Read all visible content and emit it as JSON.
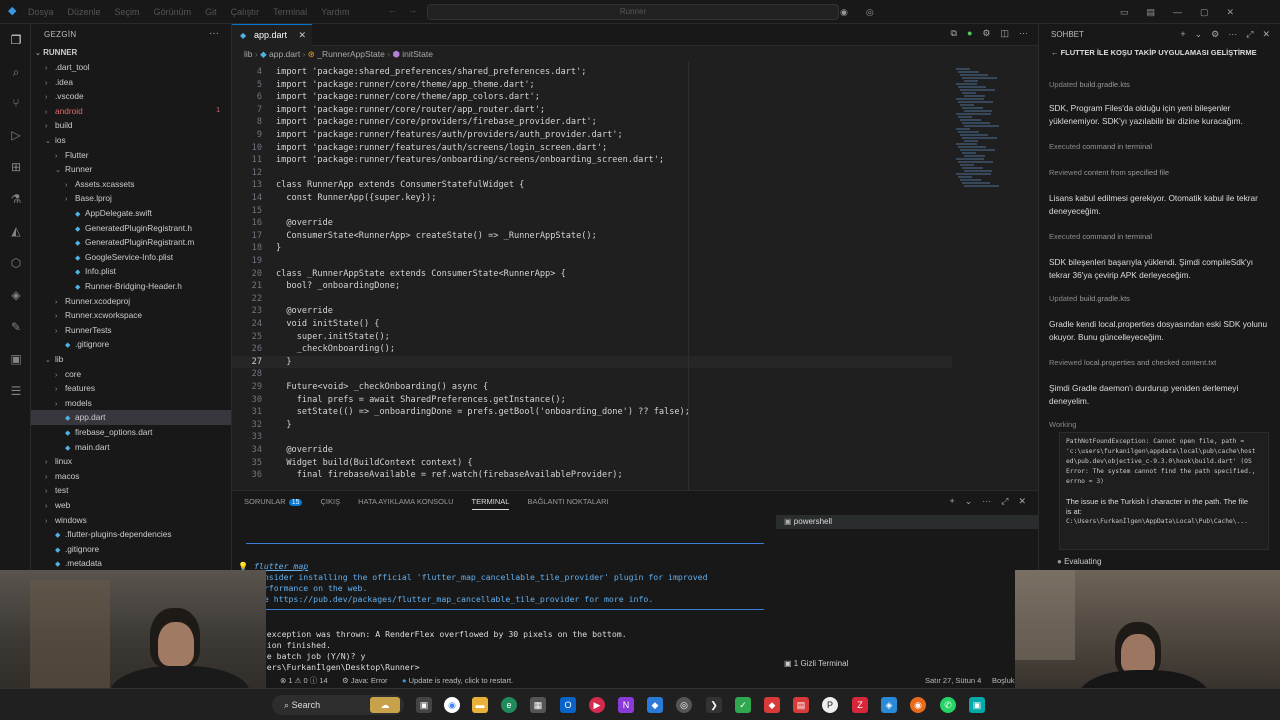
{
  "titlebar": {
    "menu": [
      "Dosya",
      "Düzenle",
      "Seçim",
      "Görünüm",
      "Git",
      "Çalıştır",
      "Terminal",
      "Yardım"
    ],
    "search": "Runner"
  },
  "explorer": {
    "header": "GEZGİN",
    "root": "RUNNER",
    "items": [
      {
        "label": ".dart_tool",
        "type": "folder",
        "depth": 1,
        "open": false
      },
      {
        "label": ".idea",
        "type": "folder",
        "depth": 1,
        "open": false
      },
      {
        "label": ".vscode",
        "type": "folder",
        "depth": 1,
        "open": false
      },
      {
        "label": "android",
        "type": "folder",
        "depth": 1,
        "open": false,
        "badge": "1",
        "error": true
      },
      {
        "label": "build",
        "type": "folder",
        "depth": 1,
        "open": false
      },
      {
        "label": "ios",
        "type": "folder",
        "depth": 1,
        "open": true
      },
      {
        "label": "Flutter",
        "type": "folder",
        "depth": 2,
        "open": false
      },
      {
        "label": "Runner",
        "type": "folder",
        "depth": 2,
        "open": true
      },
      {
        "label": "Assets.xcassets",
        "type": "folder",
        "depth": 3,
        "open": false
      },
      {
        "label": "Base.lproj",
        "type": "folder",
        "depth": 3,
        "open": false
      },
      {
        "label": "AppDelegate.swift",
        "type": "file",
        "depth": 3
      },
      {
        "label": "GeneratedPluginRegistrant.h",
        "type": "file",
        "depth": 3
      },
      {
        "label": "GeneratedPluginRegistrant.m",
        "type": "file",
        "depth": 3
      },
      {
        "label": "GoogleService-Info.plist",
        "type": "file",
        "depth": 3
      },
      {
        "label": "Info.plist",
        "type": "file",
        "depth": 3
      },
      {
        "label": "Runner-Bridging-Header.h",
        "type": "file",
        "depth": 3
      },
      {
        "label": "Runner.xcodeproj",
        "type": "folder",
        "depth": 2,
        "open": false
      },
      {
        "label": "Runner.xcworkspace",
        "type": "folder",
        "depth": 2,
        "open": false
      },
      {
        "label": "RunnerTests",
        "type": "folder",
        "depth": 2,
        "open": false
      },
      {
        "label": ".gitignore",
        "type": "file",
        "depth": 2
      },
      {
        "label": "lib",
        "type": "folder",
        "depth": 1,
        "open": true
      },
      {
        "label": "core",
        "type": "folder",
        "depth": 2,
        "open": false
      },
      {
        "label": "features",
        "type": "folder",
        "depth": 2,
        "open": false
      },
      {
        "label": "models",
        "type": "folder",
        "depth": 2,
        "open": false
      },
      {
        "label": "app.dart",
        "type": "file",
        "depth": 2,
        "selected": true
      },
      {
        "label": "firebase_options.dart",
        "type": "file",
        "depth": 2
      },
      {
        "label": "main.dart",
        "type": "file",
        "depth": 2
      },
      {
        "label": "linux",
        "type": "folder",
        "depth": 1,
        "open": false
      },
      {
        "label": "macos",
        "type": "folder",
        "depth": 1,
        "open": false
      },
      {
        "label": "test",
        "type": "folder",
        "depth": 1,
        "open": false
      },
      {
        "label": "web",
        "type": "folder",
        "depth": 1,
        "open": false
      },
      {
        "label": "windows",
        "type": "folder",
        "depth": 1,
        "open": false
      },
      {
        "label": ".flutter-plugins-dependencies",
        "type": "file",
        "depth": 1
      },
      {
        "label": ".gitignore",
        "type": "file",
        "depth": 1
      },
      {
        "label": ".metadata",
        "type": "file",
        "depth": 1
      }
    ]
  },
  "editor": {
    "tab_label": "app.dart",
    "breadcrumb": [
      "lib",
      "app.dart",
      "_RunnerAppState",
      "initState"
    ],
    "lines": [
      {
        "n": "4",
        "t": "import 'package:shared_preferences/shared_preferences.dart';"
      },
      {
        "n": "5",
        "t": "import 'package:runner/core/theme/app_theme.dart';"
      },
      {
        "n": "6",
        "t": "import 'package:runner/core/theme/app_colors.dart';"
      },
      {
        "n": "7",
        "t": "import 'package:runner/core/router/app_router.dart';"
      },
      {
        "n": "8",
        "t": "import 'package:runner/core/providers/firebase_provider.dart';"
      },
      {
        "n": "9",
        "t": "import 'package:runner/features/auth/providers/auth_provider.dart';"
      },
      {
        "n": "10",
        "t": "import 'package:runner/features/auth/screens/login_screen.dart';"
      },
      {
        "n": "11",
        "t": "import 'package:runner/features/onboarding/screens/onboarding_screen.dart';"
      },
      {
        "n": "12",
        "t": ""
      },
      {
        "n": "13",
        "t": "class RunnerApp extends ConsumerStatefulWidget {"
      },
      {
        "n": "14",
        "t": "  const RunnerApp({super.key});"
      },
      {
        "n": "15",
        "t": ""
      },
      {
        "n": "16",
        "t": "  @override"
      },
      {
        "n": "17",
        "t": "  ConsumerState<RunnerApp> createState() => _RunnerAppState();"
      },
      {
        "n": "18",
        "t": "}"
      },
      {
        "n": "19",
        "t": ""
      },
      {
        "n": "20",
        "t": "class _RunnerAppState extends ConsumerState<RunnerApp> {"
      },
      {
        "n": "21",
        "t": "  bool? _onboardingDone;"
      },
      {
        "n": "22",
        "t": ""
      },
      {
        "n": "23",
        "t": "  @override"
      },
      {
        "n": "24",
        "t": "  void initState() {"
      },
      {
        "n": "25",
        "t": "    super.initState();"
      },
      {
        "n": "26",
        "t": "    _checkOnboarding();"
      },
      {
        "n": "27",
        "t": "  }",
        "current": true
      },
      {
        "n": "28",
        "t": ""
      },
      {
        "n": "29",
        "t": "  Future<void> _checkOnboarding() async {"
      },
      {
        "n": "30",
        "t": "    final prefs = await SharedPreferences.getInstance();"
      },
      {
        "n": "31",
        "t": "    setState(() => _onboardingDone = prefs.getBool('onboarding_done') ?? false);"
      },
      {
        "n": "32",
        "t": "  }"
      },
      {
        "n": "33",
        "t": ""
      },
      {
        "n": "34",
        "t": "  @override"
      },
      {
        "n": "35",
        "t": "  Widget build(BuildContext context) {"
      },
      {
        "n": "36",
        "t": "    final firebaseAvailable = ref.watch(firebaseAvailableProvider);"
      }
    ]
  },
  "panel": {
    "tabs": [
      "SORUNLAR",
      "ÇIKIŞ",
      "HATA AYIKLAMA KONSOLU",
      "TERMINAL",
      "BAĞLANTI NOKTALARI"
    ],
    "problems_count": "15",
    "active_tab": "TERMINAL",
    "terminal_lines": [
      "flutter_map",
      "Consider installing the official 'flutter_map_cancellable_tile_provider' plugin for improved",
      "performance on the web.",
      "See https://pub.dev/packages/flutter_map_cancellable_tile_provider for more info.",
      "er exception was thrown: A RenderFlex overflowed by 30 pixels on the bottom.",
      "cation finished.",
      "nate batch job (Y/N)? y",
      "\\Users\\Furkanİlgen\\Desktop\\Runner> "
    ],
    "shell_label": "powershell",
    "hidden_terminal": "1 Gizli Terminal"
  },
  "statusbar": {
    "errors": "1",
    "warnings": "0",
    "infos": "14",
    "java": "Java: Error",
    "update": "Update is ready, click to restart.",
    "position": "Satır 27, Sütun 4",
    "encoding": "Boşluk"
  },
  "chat": {
    "header": "SOHBET",
    "title": "FLUTTER İLE KOŞU TAKİP UYGULAMASI GELİŞTİRME",
    "entries": [
      {
        "kind": "meta",
        "verb": "Updated",
        "obj": "build.gradle.kts"
      },
      {
        "kind": "msg",
        "text": "SDK, Program Files'da olduğu için yeni bileşenler yüklenemiyor. SDK'yı yazılabilir bir dizine kuracağım."
      },
      {
        "kind": "meta",
        "verb": "Executed",
        "obj": "command in terminal"
      },
      {
        "kind": "meta",
        "verb": "Reviewed",
        "obj": "content from specified file"
      },
      {
        "kind": "msg",
        "text": "Lisans kabul edilmesi gerekiyor. Otomatik kabul ile tekrar deneyeceğim."
      },
      {
        "kind": "meta",
        "verb": "Executed",
        "obj": "command in terminal"
      },
      {
        "kind": "msg",
        "text": "SDK bileşenleri başarıyla yüklendi. Şimdi compileSdk'yı tekrar 36'ya çevirip APK derleyeceğim."
      },
      {
        "kind": "meta",
        "verb": "Updated",
        "obj": "build.gradle.kts"
      },
      {
        "kind": "msg",
        "text": "Gradle kendi local.properties dosyasından eski SDK yolunu okuyor. Bunu güncelleyeceğim."
      },
      {
        "kind": "meta",
        "verb": "Reviewed",
        "obj": "local.properties and checked content.txt"
      },
      {
        "kind": "msg",
        "text": "Şimdi Gradle daemon'ı durdurup yeniden derlemeyi deneyelim."
      },
      {
        "kind": "meta",
        "verb": "Working",
        "obj": ""
      }
    ],
    "code_lines": [
      "PathNotFoundException: Cannot open file, path =",
      "'c:\\users\\furkanilgen\\appdata\\local\\pub\\cache\\host",
      "ed\\pub.dev\\objective_c-9.3.0\\hook\\build.dart' (OS",
      "Error: The system cannot find the path specified.,",
      "errno = 3)",
      "",
      "The issue is the Turkish İ character in the path. The file",
      "is at:",
      "C:\\Users\\Furkanİlgen\\AppData\\Local\\Pub\\Cache\\..."
    ],
    "status": "Evaluating"
  },
  "taskbar": {
    "search_label": "Search"
  }
}
